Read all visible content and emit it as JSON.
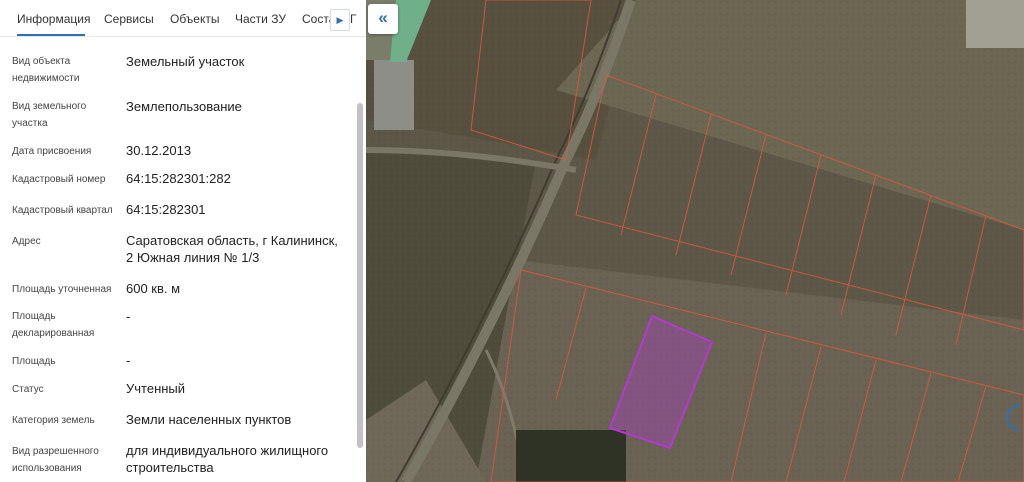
{
  "tabs": [
    {
      "label": "Информация",
      "active": true
    },
    {
      "label": "Сервисы"
    },
    {
      "label": "Объекты"
    },
    {
      "label": "Части ЗУ"
    },
    {
      "label": "Соста"
    },
    {
      "label": "Г"
    }
  ],
  "tabs_next_icon": "caret-right-icon",
  "collapse_icon": "double-chevron-left-icon",
  "fields": [
    {
      "label": "Вид объекта недвижимости",
      "value": "Земельный участок"
    },
    {
      "label": "Вид земельного участка",
      "value": "Землепользование"
    },
    {
      "label": "Дата присвоения",
      "value": "30.12.2013"
    },
    {
      "label": "Кадастровый номер",
      "value": "64:15:282301:282"
    },
    {
      "label": "Кадастровый квартал",
      "value": "64:15:282301"
    },
    {
      "label": "Адрес",
      "value": "Саратовская область, г Калининск, 2 Южная линия № 1/3"
    },
    {
      "label": "Площадь уточненная",
      "value": "600 кв. м"
    },
    {
      "label": "Площадь декларированная",
      "value": "-"
    },
    {
      "label": "Площадь",
      "value": "-"
    },
    {
      "label": "Статус",
      "value": "Учтенный"
    },
    {
      "label": "Категория земель",
      "value": "Земли населенных пунктов"
    },
    {
      "label": "Вид разрешенного использования",
      "value": "для индивидуального жилищного строительства"
    }
  ],
  "colors": {
    "accent": "#2f6fb3",
    "parcel_outline": "#e2553f",
    "selected_parcel": "#b23ad0"
  }
}
